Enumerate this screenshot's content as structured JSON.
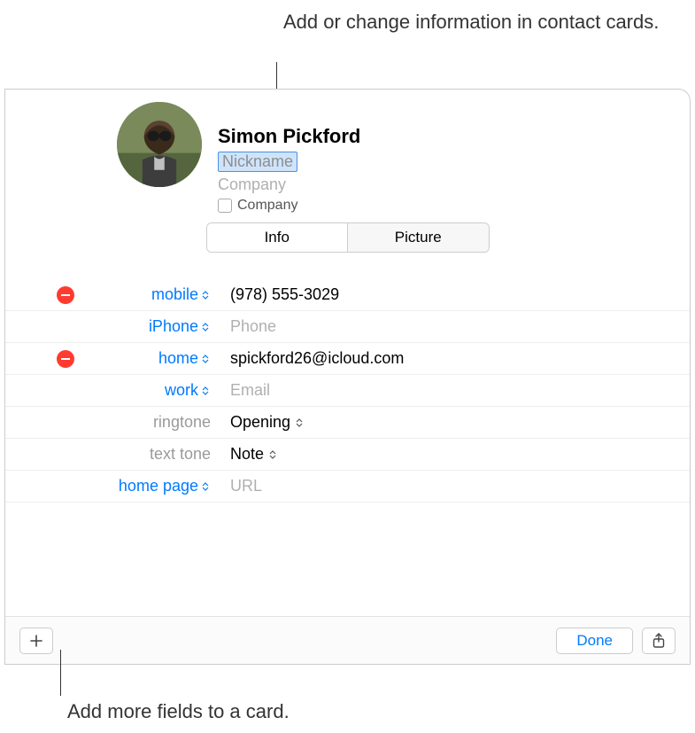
{
  "callouts": {
    "top": "Add or change information in contact cards.",
    "bottom": "Add more fields to a card."
  },
  "contact": {
    "name": "Simon Pickford",
    "nickname_placeholder": "Nickname",
    "company_placeholder": "Company",
    "company_checkbox_label": "Company"
  },
  "tabs": {
    "info": "Info",
    "picture": "Picture"
  },
  "fields": [
    {
      "label": "mobile",
      "label_style": "blue",
      "has_remove": true,
      "has_popup": true,
      "value": "(978) 555-3029",
      "placeholder": ""
    },
    {
      "label": "iPhone",
      "label_style": "blue",
      "has_remove": false,
      "has_popup": true,
      "value": "",
      "placeholder": "Phone"
    },
    {
      "label": "home",
      "label_style": "blue",
      "has_remove": true,
      "has_popup": true,
      "value": "spickford26@icloud.com",
      "placeholder": ""
    },
    {
      "label": "work",
      "label_style": "blue",
      "has_remove": false,
      "has_popup": true,
      "value": "",
      "placeholder": "Email"
    },
    {
      "label": "ringtone",
      "label_style": "gray",
      "has_remove": false,
      "has_popup": false,
      "value": "Opening",
      "placeholder": "",
      "value_popup": true
    },
    {
      "label": "text tone",
      "label_style": "gray",
      "has_remove": false,
      "has_popup": false,
      "value": "Note",
      "placeholder": "",
      "value_popup": true
    },
    {
      "label": "home page",
      "label_style": "blue",
      "has_remove": false,
      "has_popup": true,
      "value": "",
      "placeholder": "URL"
    }
  ],
  "footer": {
    "done_label": "Done"
  }
}
